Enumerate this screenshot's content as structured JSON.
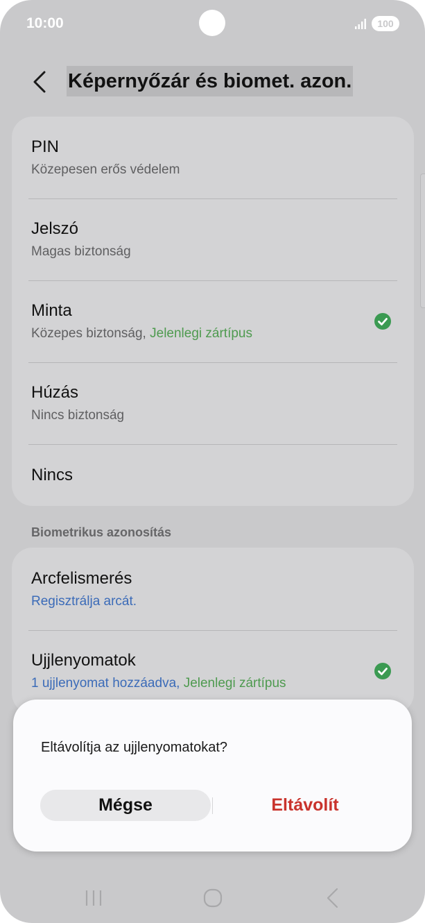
{
  "status_bar": {
    "time": "10:00",
    "battery": "100"
  },
  "header": {
    "title": "Képernyőzár és biomet. azon."
  },
  "lock_types": [
    {
      "title": "PIN",
      "subtitle": "Közepesen erős védelem"
    },
    {
      "title": "Jelszó",
      "subtitle": "Magas biztonság"
    },
    {
      "title": "Minta",
      "subtitle": "Közepes biztonság, ",
      "subtitle_accent": "Jelenlegi zártípus",
      "selected": true
    },
    {
      "title": "Húzás",
      "subtitle": "Nincs biztonság"
    },
    {
      "title": "Nincs"
    }
  ],
  "biometrics": {
    "section_label": "Biometrikus azonosítás",
    "items": [
      {
        "title": "Arcfelismerés",
        "subtitle": "Regisztrálja arcát."
      },
      {
        "title": "Ujjlenyomatok",
        "subtitle": "1 ujjlenyomat hozzáadva, ",
        "subtitle_accent": "Jelenlegi zártípus",
        "selected": true
      }
    ]
  },
  "dialog": {
    "message": "Eltávolítja az ujjlenyomatokat?",
    "cancel_label": "Mégse",
    "confirm_label": "Eltávolít"
  },
  "colors": {
    "accent_green": "#4e9a4f",
    "accent_blue": "#3b6bb8",
    "destructive_red": "#c9332c"
  },
  "icons": {
    "back": "chevron-left-icon",
    "check": "check-circle-icon",
    "nav_recent": "recent-apps-icon",
    "nav_home": "home-icon",
    "nav_back": "nav-back-icon"
  }
}
